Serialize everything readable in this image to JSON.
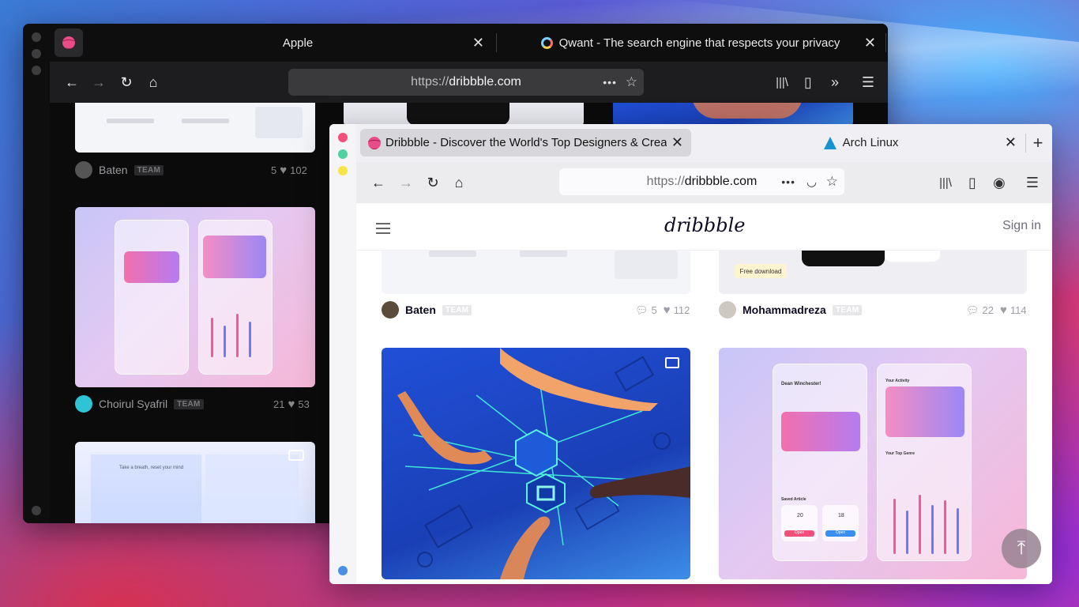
{
  "dark_window": {
    "tabs": [
      {
        "label": "Apple"
      },
      {
        "label": "Qwant - The search engine that respects your privacy"
      }
    ],
    "url_prefix": "https://",
    "url_domain": "dribbble.com",
    "shots": [
      {
        "author": "Baten",
        "badge": "TEAM",
        "comments": "5",
        "likes": "102"
      },
      {
        "author": "Choirul Syafril",
        "badge": "TEAM",
        "comments": "21",
        "likes": "53"
      },
      {
        "card_heading": "Take a breath, reset your mind"
      }
    ]
  },
  "light_window": {
    "tabs": [
      {
        "label": "Dribbble - Discover the World's Top Designers & Creative Professionals"
      },
      {
        "label": "Arch Linux"
      }
    ],
    "url_prefix": "https://",
    "url_domain": "dribbble.com",
    "site": {
      "logo": "dribbble",
      "signin": "Sign in"
    },
    "shots": [
      {
        "author": "Baten",
        "badge": "TEAM",
        "comments": "5",
        "likes": "112"
      },
      {
        "author": "Mohammadreza",
        "badge": "TEAM",
        "comments": "22",
        "likes": "114",
        "tag": "Free download"
      }
    ],
    "preview": {
      "greeting": "Dean Winchester!",
      "activity": "Your Activity",
      "genre": "Your Top Genre",
      "saved": "Saved Article",
      "n1": "20",
      "n2": "18",
      "open": "Open"
    }
  },
  "colors": {
    "dribbble_pink": "#ea4c89",
    "arch_blue": "#1793d1",
    "dot_red": "#f0507a",
    "dot_green": "#4fd1a1",
    "dot_yellow": "#f5e548",
    "dot_blue": "#4a90e2"
  }
}
